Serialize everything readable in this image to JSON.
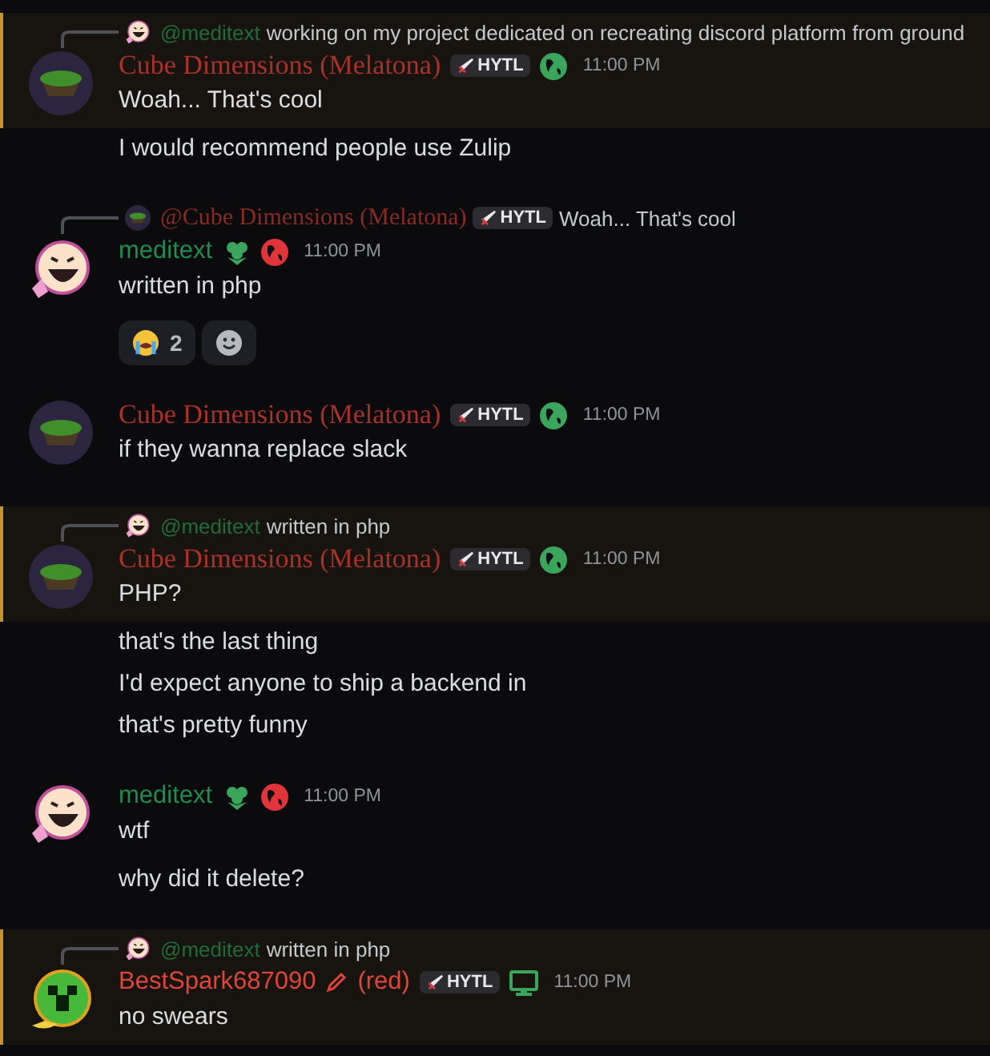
{
  "messages": [
    {
      "highlighted": true,
      "avatar": {
        "kind": "planet"
      },
      "reply": {
        "avatar": {
          "kind": "smiley"
        },
        "author": {
          "text": "@meditext",
          "color": "#1f6b3a",
          "kind": "sans"
        },
        "text": "working on my project dedicated on recreating discord platform from ground"
      },
      "author": {
        "text": "Cube Dimensions (Melatona)",
        "color": "#a8322a",
        "kind": "serif"
      },
      "tag": "HYTL",
      "badges": [
        {
          "kind": "globe",
          "color": "#3ba55c"
        }
      ],
      "time": "11:00 PM",
      "content": "Woah... That's cool",
      "followups": [
        "I would recommend people use Zulip"
      ]
    },
    {
      "highlighted": false,
      "avatar": {
        "kind": "smiley"
      },
      "reply": {
        "avatar": {
          "kind": "planet"
        },
        "author": {
          "text": "@Cube Dimensions (Melatona)",
          "color": "#8a2a24",
          "kind": "serif"
        },
        "tag": "HYTL",
        "text": "Woah... That's cool"
      },
      "author": {
        "text": "meditext",
        "color": "#1f8b4c",
        "kind": "sans"
      },
      "badges": [
        {
          "kind": "clover",
          "color": "#3ba55c"
        },
        {
          "kind": "globe",
          "color": "#e0333a"
        }
      ],
      "time": "11:00 PM",
      "content": "written in php",
      "reactions": [
        {
          "kind": "crying",
          "count": "2"
        },
        {
          "kind": "add"
        }
      ]
    },
    {
      "highlighted": false,
      "avatar": {
        "kind": "planet"
      },
      "author": {
        "text": "Cube Dimensions (Melatona)",
        "color": "#a8322a",
        "kind": "serif"
      },
      "tag": "HYTL",
      "badges": [
        {
          "kind": "globe",
          "color": "#3ba55c"
        }
      ],
      "time": "11:00 PM",
      "content": "if they wanna replace slack"
    },
    {
      "highlighted": true,
      "avatar": {
        "kind": "planet"
      },
      "reply": {
        "avatar": {
          "kind": "smiley"
        },
        "author": {
          "text": "@meditext",
          "color": "#1f6b3a",
          "kind": "sans"
        },
        "text": "written in php"
      },
      "author": {
        "text": "Cube Dimensions (Melatona)",
        "color": "#a8322a",
        "kind": "serif"
      },
      "tag": "HYTL",
      "badges": [
        {
          "kind": "globe",
          "color": "#3ba55c"
        }
      ],
      "time": "11:00 PM",
      "content": "PHP?",
      "followups": [
        "that's the last thing",
        "I'd expect anyone to ship a backend in",
        "that's pretty funny"
      ]
    },
    {
      "highlighted": false,
      "avatar": {
        "kind": "smiley"
      },
      "author": {
        "text": "meditext",
        "color": "#1f8b4c",
        "kind": "sans"
      },
      "badges": [
        {
          "kind": "clover",
          "color": "#3ba55c"
        },
        {
          "kind": "globe",
          "color": "#e0333a"
        }
      ],
      "time": "11:00 PM",
      "content": "wtf",
      "followups": [
        "why did it delete?"
      ]
    },
    {
      "highlighted": true,
      "avatar": {
        "kind": "creeper"
      },
      "reply": {
        "avatar": {
          "kind": "smiley"
        },
        "author": {
          "text": "@meditext",
          "color": "#1f6b3a",
          "kind": "sans"
        },
        "text": "written in php"
      },
      "author": {
        "text": "BestSpark687090",
        "color": "#e0453a",
        "kind": "sans"
      },
      "author_suffix": "(red)",
      "tag": "HYTL",
      "badges": [
        {
          "kind": "monitor",
          "color": "#3ba55c"
        }
      ],
      "time": "11:00 PM",
      "content": "no swears"
    }
  ]
}
